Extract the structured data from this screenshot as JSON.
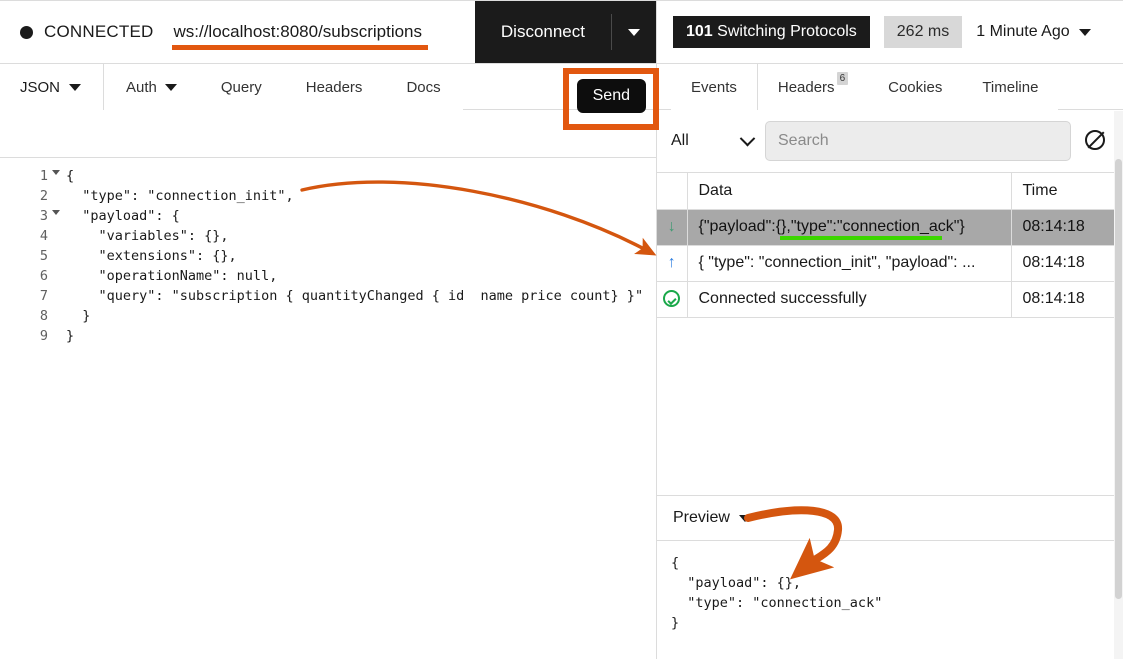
{
  "connection": {
    "status_label": "CONNECTED",
    "url": "ws://localhost:8080/subscriptions",
    "disconnect_label": "Disconnect",
    "accent_color": "#e2570f"
  },
  "request_panel": {
    "body_type": "JSON",
    "tabs": [
      {
        "label": "Auth",
        "has_caret": true
      },
      {
        "label": "Query",
        "has_caret": false
      },
      {
        "label": "Headers",
        "has_caret": false
      },
      {
        "label": "Docs",
        "has_caret": false
      }
    ],
    "send_label": "Send",
    "editor_lines": [
      {
        "n": "1",
        "fold": true,
        "text": "{"
      },
      {
        "n": "2",
        "fold": false,
        "text": "  \"type\": \"connection_init\","
      },
      {
        "n": "3",
        "fold": true,
        "text": "  \"payload\": {"
      },
      {
        "n": "4",
        "fold": false,
        "text": "    \"variables\": {},"
      },
      {
        "n": "5",
        "fold": false,
        "text": "    \"extensions\": {},"
      },
      {
        "n": "6",
        "fold": false,
        "text": "    \"operationName\": null,"
      },
      {
        "n": "7",
        "fold": false,
        "text": "    \"query\": \"subscription { quantityChanged { id  name price count} }\""
      },
      {
        "n": "8",
        "fold": false,
        "text": "  }"
      },
      {
        "n": "9",
        "fold": false,
        "text": "}"
      }
    ]
  },
  "response_panel": {
    "status_code": "101",
    "status_text": "Switching Protocols",
    "duration": "262 ms",
    "timestamp_label": "1 Minute Ago",
    "tabs": [
      {
        "label": "Events",
        "badge": "",
        "active": true
      },
      {
        "label": "Headers",
        "badge": "6",
        "active": false
      },
      {
        "label": "Cookies",
        "badge": "",
        "active": false
      },
      {
        "label": "Timeline",
        "badge": "",
        "active": false
      }
    ],
    "filter_value": "All",
    "search_placeholder": "Search",
    "clear_icon": "clear-events-icon",
    "table": {
      "headers": [
        "",
        "Data",
        "Time"
      ],
      "rows": [
        {
          "direction": "received",
          "icon": "arrow-down-icon",
          "data": "{\"payload\":{},\"type\":\"connection_ack\"}",
          "time": "08:14:18",
          "selected": true,
          "highlight_color": "#3cd600"
        },
        {
          "direction": "sent",
          "icon": "arrow-up-icon",
          "data": "{ \"type\": \"connection_init\", \"payload\": ...",
          "time": "08:14:18",
          "selected": false
        },
        {
          "direction": "info",
          "icon": "check-circle-icon",
          "data": "Connected successfully",
          "time": "08:14:18",
          "selected": false
        }
      ]
    },
    "preview": {
      "label": "Preview",
      "content": "{\n  \"payload\": {},\n  \"type\": \"connection_ack\"\n}"
    }
  }
}
